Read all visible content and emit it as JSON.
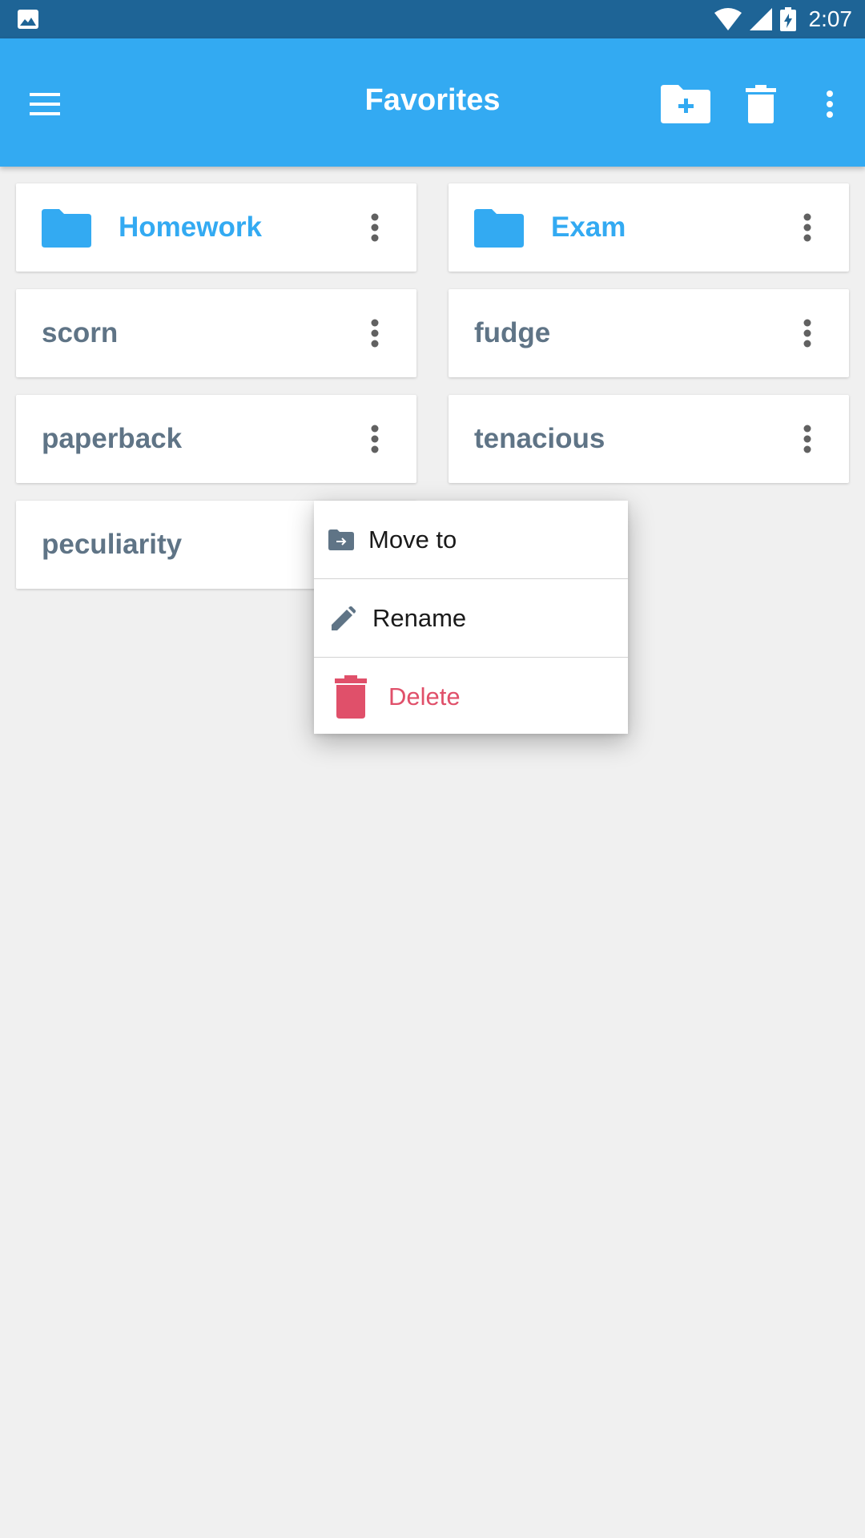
{
  "status_bar": {
    "time": "2:07",
    "icons": [
      "gallery-icon",
      "wifi-icon",
      "signal-icon",
      "battery-charging-icon"
    ]
  },
  "app_bar": {
    "title": "Favorites",
    "actions": [
      "menu-icon",
      "new-folder-icon",
      "trash-icon",
      "overflow-menu-icon"
    ],
    "color": "#33aaf2"
  },
  "cards": [
    {
      "label": "Homework",
      "type": "folder"
    },
    {
      "label": "Exam",
      "type": "folder"
    },
    {
      "label": "scorn",
      "type": "note"
    },
    {
      "label": "fudge",
      "type": "note"
    },
    {
      "label": "paperback",
      "type": "note"
    },
    {
      "label": "tenacious",
      "type": "note"
    },
    {
      "label": "peculiarity",
      "type": "note"
    }
  ],
  "popup_menu": {
    "items": [
      {
        "label": "Move to",
        "icon": "move-to-folder-icon"
      },
      {
        "label": "Rename",
        "icon": "pencil-icon"
      },
      {
        "label": "Delete",
        "icon": "trash-icon",
        "color": "#e0506a"
      }
    ]
  },
  "colors": {
    "status_bar": "#1e6496",
    "accent": "#33aaf2",
    "note_text": "#5f7486",
    "background": "#f0f0f0",
    "delete": "#e0506a"
  }
}
